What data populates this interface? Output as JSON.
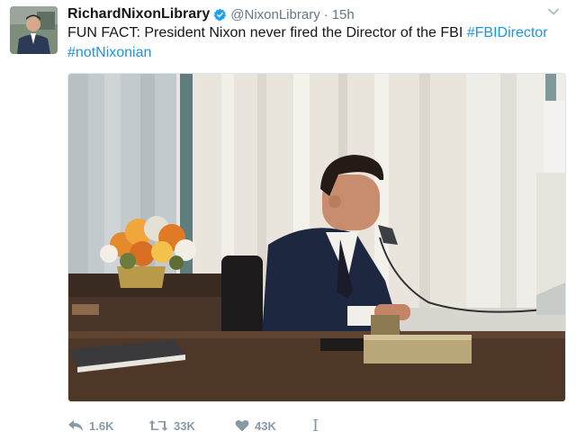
{
  "tweet": {
    "display_name": "RichardNixonLibrary",
    "handle": "@NixonLibrary",
    "separator": "·",
    "time": "15h",
    "text_prefix": "FUN FACT: President Nixon never fired the Director of the FBI",
    "hashtag_1": "#FBIDirector",
    "hashtag_2": "#notNixonian",
    "verified_icon": "verified-badge-icon",
    "menu_icon": "chevron-down-icon",
    "accent_color": "#1b95e0"
  },
  "actions": {
    "reply_count": "1.6K",
    "retweet_count": "33K",
    "like_count": "43K",
    "more_label": "I"
  }
}
